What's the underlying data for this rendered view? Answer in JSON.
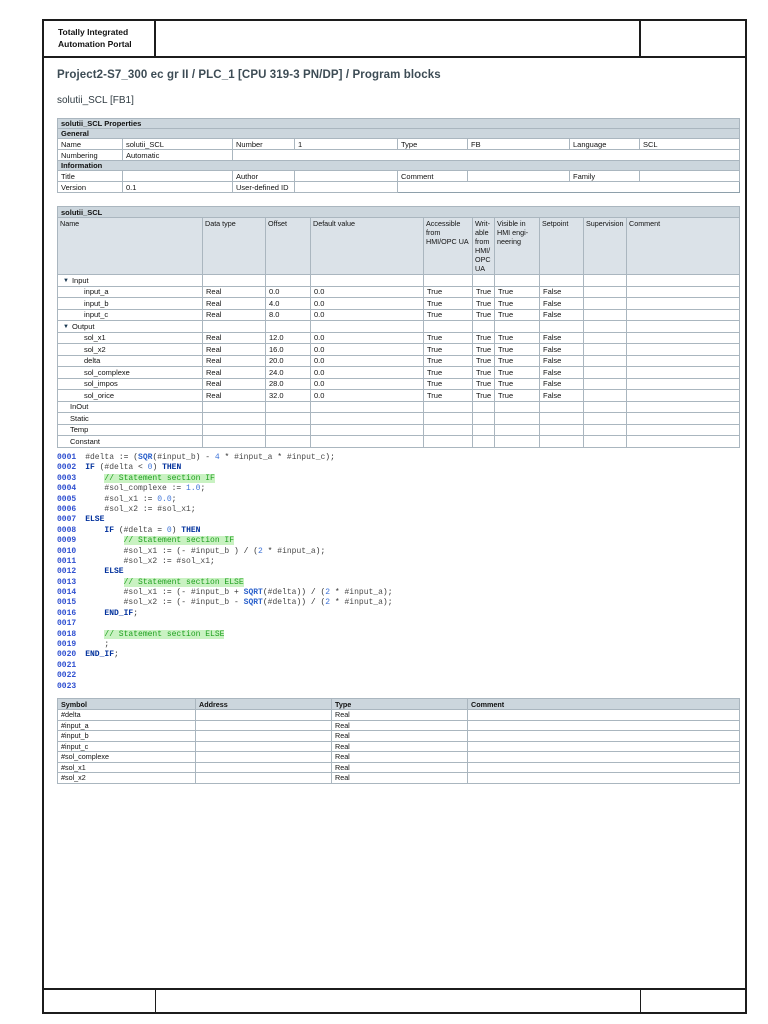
{
  "portal": {
    "line1": "Totally Integrated",
    "line2": "Automation Portal"
  },
  "page": {
    "breadcrumb": "Project2-S7_300 ec gr II / PLC_1 [CPU 319-3 PN/DP] / Program blocks",
    "subtitle": "solutii_SCL [FB1]"
  },
  "properties": {
    "title": "solutii_SCL Properties",
    "general_label": "General",
    "information_label": "Information",
    "name_label": "Name",
    "name": "solutii_SCL",
    "number_label": "Number",
    "number": "1",
    "type_label": "Type",
    "type": "FB",
    "language_label": "Language",
    "language": "SCL",
    "numbering_label": "Numbering",
    "numbering": "Automatic",
    "title_label": "Title",
    "title_value": "",
    "author_label": "Author",
    "author": "",
    "comment_label": "Comment",
    "comment": "",
    "family_label": "Family",
    "family": "",
    "version_label": "Version",
    "version": "0.1",
    "user_defined_id_label": "User-defined ID",
    "user_defined_id": ""
  },
  "variable_table": {
    "title": "solutii_SCL",
    "columns": [
      "Name",
      "Data type",
      "Offset",
      "Default value",
      "Accessible from HMI/OPC UA",
      "Writ­able from HMI/ OPC UA",
      "Visible in HMI engi­neering",
      "Setpoint",
      "Supervi­sion",
      "Comment"
    ],
    "rows": [
      {
        "kind": "section",
        "name": "Input"
      },
      {
        "kind": "var",
        "name": "input_a",
        "data_type": "Real",
        "offset": "0.0",
        "default_value": "0.0",
        "accessible": "True",
        "writable": "True",
        "visible": "True",
        "setpoint": "False",
        "supervision": "",
        "comment": ""
      },
      {
        "kind": "var",
        "name": "input_b",
        "data_type": "Real",
        "offset": "4.0",
        "default_value": "0.0",
        "accessible": "True",
        "writable": "True",
        "visible": "True",
        "setpoint": "False",
        "supervision": "",
        "comment": ""
      },
      {
        "kind": "var",
        "name": "input_c",
        "data_type": "Real",
        "offset": "8.0",
        "default_value": "0.0",
        "accessible": "True",
        "writable": "True",
        "visible": "True",
        "setpoint": "False",
        "supervision": "",
        "comment": ""
      },
      {
        "kind": "section",
        "name": "Output"
      },
      {
        "kind": "var",
        "name": "sol_x1",
        "data_type": "Real",
        "offset": "12.0",
        "default_value": "0.0",
        "accessible": "True",
        "writable": "True",
        "visible": "True",
        "setpoint": "False",
        "supervision": "",
        "comment": ""
      },
      {
        "kind": "var",
        "name": "sol_x2",
        "data_type": "Real",
        "offset": "16.0",
        "default_value": "0.0",
        "accessible": "True",
        "writable": "True",
        "visible": "True",
        "setpoint": "False",
        "supervision": "",
        "comment": ""
      },
      {
        "kind": "var",
        "name": "delta",
        "data_type": "Real",
        "offset": "20.0",
        "default_value": "0.0",
        "accessible": "True",
        "writable": "True",
        "visible": "True",
        "setpoint": "False",
        "supervision": "",
        "comment": ""
      },
      {
        "kind": "var",
        "name": "sol_complexe",
        "data_type": "Real",
        "offset": "24.0",
        "default_value": "0.0",
        "accessible": "True",
        "writable": "True",
        "visible": "True",
        "setpoint": "False",
        "supervision": "",
        "comment": ""
      },
      {
        "kind": "var",
        "name": "sol_impos",
        "data_type": "Real",
        "offset": "28.0",
        "default_value": "0.0",
        "accessible": "True",
        "writable": "True",
        "visible": "True",
        "setpoint": "False",
        "supervision": "",
        "comment": ""
      },
      {
        "kind": "var",
        "name": "sol_orice",
        "data_type": "Real",
        "offset": "32.0",
        "default_value": "0.0",
        "accessible": "True",
        "writable": "True",
        "visible": "True",
        "setpoint": "False",
        "supervision": "",
        "comment": ""
      },
      {
        "kind": "group",
        "name": "InOut"
      },
      {
        "kind": "group",
        "name": "Static"
      },
      {
        "kind": "group",
        "name": "Temp"
      },
      {
        "kind": "group",
        "name": "Constant"
      }
    ]
  },
  "code": {
    "lines": [
      {
        "num": "0001",
        "t": [
          [
            "v",
            "#delta"
          ],
          [
            "o",
            " := ("
          ],
          [
            "f",
            "SQR"
          ],
          [
            "o",
            "("
          ],
          [
            "v",
            "#input_b"
          ],
          [
            "o",
            ") - "
          ],
          [
            "n",
            "4"
          ],
          [
            "o",
            " * "
          ],
          [
            "v",
            "#input_a"
          ],
          [
            "o",
            " * "
          ],
          [
            "v",
            "#input_c"
          ],
          [
            "o",
            ");"
          ]
        ]
      },
      {
        "num": "0002",
        "t": [
          [
            "k",
            "IF"
          ],
          [
            "o",
            " ("
          ],
          [
            "v",
            "#delta"
          ],
          [
            "o",
            " < "
          ],
          [
            "n",
            "0"
          ],
          [
            "o",
            ") "
          ],
          [
            "k",
            "THEN"
          ]
        ]
      },
      {
        "num": "0003",
        "t": [
          [
            "o",
            "    "
          ],
          [
            "c",
            "// Statement section IF"
          ]
        ]
      },
      {
        "num": "0004",
        "t": [
          [
            "o",
            "    "
          ],
          [
            "v",
            "#sol_complexe"
          ],
          [
            "o",
            " := "
          ],
          [
            "n",
            "1.0"
          ],
          [
            "o",
            ";"
          ]
        ]
      },
      {
        "num": "0005",
        "t": [
          [
            "o",
            "    "
          ],
          [
            "v",
            "#sol_x1"
          ],
          [
            "o",
            " := "
          ],
          [
            "n",
            "0.0"
          ],
          [
            "o",
            ";"
          ]
        ]
      },
      {
        "num": "0006",
        "t": [
          [
            "o",
            "    "
          ],
          [
            "v",
            "#sol_x2"
          ],
          [
            "o",
            " := "
          ],
          [
            "v",
            "#sol_x1"
          ],
          [
            "o",
            ";"
          ]
        ]
      },
      {
        "num": "0007",
        "t": [
          [
            "k",
            "ELSE"
          ]
        ]
      },
      {
        "num": "0008",
        "t": [
          [
            "o",
            "    "
          ],
          [
            "k",
            "IF"
          ],
          [
            "o",
            " ("
          ],
          [
            "v",
            "#delta"
          ],
          [
            "o",
            " = "
          ],
          [
            "n",
            "0"
          ],
          [
            "o",
            ") "
          ],
          [
            "k",
            "THEN"
          ]
        ]
      },
      {
        "num": "0009",
        "t": [
          [
            "o",
            "        "
          ],
          [
            "c",
            "// Statement section IF"
          ]
        ]
      },
      {
        "num": "0010",
        "t": [
          [
            "o",
            "        "
          ],
          [
            "v",
            "#sol_x1"
          ],
          [
            "o",
            " := (- "
          ],
          [
            "v",
            "#input_b"
          ],
          [
            "o",
            " ) / ("
          ],
          [
            "n",
            "2"
          ],
          [
            "o",
            " * "
          ],
          [
            "v",
            "#input_a"
          ],
          [
            "o",
            ");"
          ]
        ]
      },
      {
        "num": "0011",
        "t": [
          [
            "o",
            "        "
          ],
          [
            "v",
            "#sol_x2"
          ],
          [
            "o",
            " := "
          ],
          [
            "v",
            "#sol_x1"
          ],
          [
            "o",
            ";"
          ]
        ]
      },
      {
        "num": "0012",
        "t": [
          [
            "o",
            "    "
          ],
          [
            "k",
            "ELSE"
          ]
        ]
      },
      {
        "num": "0013",
        "t": [
          [
            "o",
            "        "
          ],
          [
            "c",
            "// Statement section ELSE"
          ]
        ]
      },
      {
        "num": "0014",
        "t": [
          [
            "o",
            "        "
          ],
          [
            "v",
            "#sol_x1"
          ],
          [
            "o",
            " := (- "
          ],
          [
            "v",
            "#input_b"
          ],
          [
            "o",
            " + "
          ],
          [
            "f",
            "SQRT"
          ],
          [
            "o",
            "("
          ],
          [
            "v",
            "#delta"
          ],
          [
            "o",
            ")) / ("
          ],
          [
            "n",
            "2"
          ],
          [
            "o",
            " * "
          ],
          [
            "v",
            "#input_a"
          ],
          [
            "o",
            ");"
          ]
        ]
      },
      {
        "num": "0015",
        "t": [
          [
            "o",
            "        "
          ],
          [
            "v",
            "#sol_x2"
          ],
          [
            "o",
            " := (- "
          ],
          [
            "v",
            "#input_b"
          ],
          [
            "o",
            " - "
          ],
          [
            "f",
            "SQRT"
          ],
          [
            "o",
            "("
          ],
          [
            "v",
            "#delta"
          ],
          [
            "o",
            ")) / ("
          ],
          [
            "n",
            "2"
          ],
          [
            "o",
            " * "
          ],
          [
            "v",
            "#input_a"
          ],
          [
            "o",
            ");"
          ]
        ]
      },
      {
        "num": "0016",
        "t": [
          [
            "o",
            "    "
          ],
          [
            "k",
            "END_IF"
          ],
          [
            "o",
            ";"
          ]
        ]
      },
      {
        "num": "0017",
        "t": []
      },
      {
        "num": "0018",
        "t": [
          [
            "o",
            "    "
          ],
          [
            "c",
            "// Statement section ELSE"
          ]
        ]
      },
      {
        "num": "0019",
        "t": [
          [
            "o",
            "    ;"
          ]
        ]
      },
      {
        "num": "0020",
        "t": [
          [
            "k",
            "END_IF"
          ],
          [
            "o",
            ";"
          ]
        ]
      },
      {
        "num": "0021",
        "t": []
      },
      {
        "num": "0022",
        "t": []
      },
      {
        "num": "0023",
        "t": []
      }
    ]
  },
  "symbol_table": {
    "columns": [
      "Symbol",
      "Address",
      "Type",
      "Comment"
    ],
    "rows": [
      [
        "#delta",
        "",
        "Real",
        ""
      ],
      [
        "#input_a",
        "",
        "Real",
        ""
      ],
      [
        "#input_b",
        "",
        "Real",
        ""
      ],
      [
        "#input_c",
        "",
        "Real",
        ""
      ],
      [
        "#sol_complexe",
        "",
        "Real",
        ""
      ],
      [
        "#sol_x1",
        "",
        "Real",
        ""
      ],
      [
        "#sol_x2",
        "",
        "Real",
        ""
      ]
    ]
  }
}
